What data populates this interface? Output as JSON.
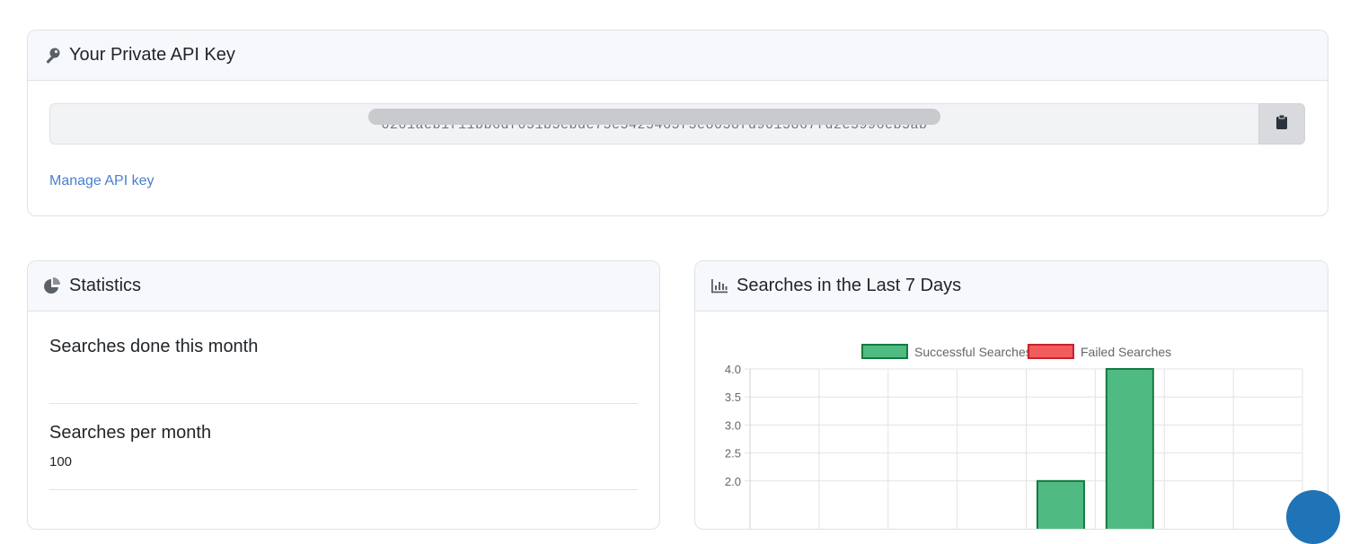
{
  "api_key": {
    "title": "Your Private API Key",
    "key_value": "0201aeb1f11bb6df051b5ebde75e5425465f5e8058fd9015867fd2e5996eb5ab",
    "manage_link": "Manage API key"
  },
  "statistics": {
    "title": "Statistics",
    "items": [
      {
        "label": "Searches done this month",
        "value": ""
      },
      {
        "label": "Searches per month",
        "value": "100"
      }
    ]
  },
  "searches_chart": {
    "title": "Searches in the Last 7 Days"
  },
  "colors": {
    "success_fill": "#4fbb82",
    "success_border": "#137a3f",
    "failed_fill": "#f25c5c",
    "failed_border": "#c8232c",
    "link": "#4a7fcf"
  },
  "chart_data": {
    "type": "bar",
    "categories": [
      "",
      "",
      "",
      "",
      "",
      "",
      "",
      ""
    ],
    "series": [
      {
        "name": "Successful Searches",
        "values": [
          0,
          0,
          0,
          0,
          2,
          4,
          0,
          0
        ]
      },
      {
        "name": "Failed Searches",
        "values": [
          0,
          0,
          0,
          0,
          0,
          0,
          0,
          0
        ]
      }
    ],
    "ylim": [
      0,
      4
    ],
    "yticks": [
      "4.0",
      "3.5",
      "3.0",
      "2.5",
      "2.0"
    ],
    "grid": true,
    "legend": "top"
  }
}
